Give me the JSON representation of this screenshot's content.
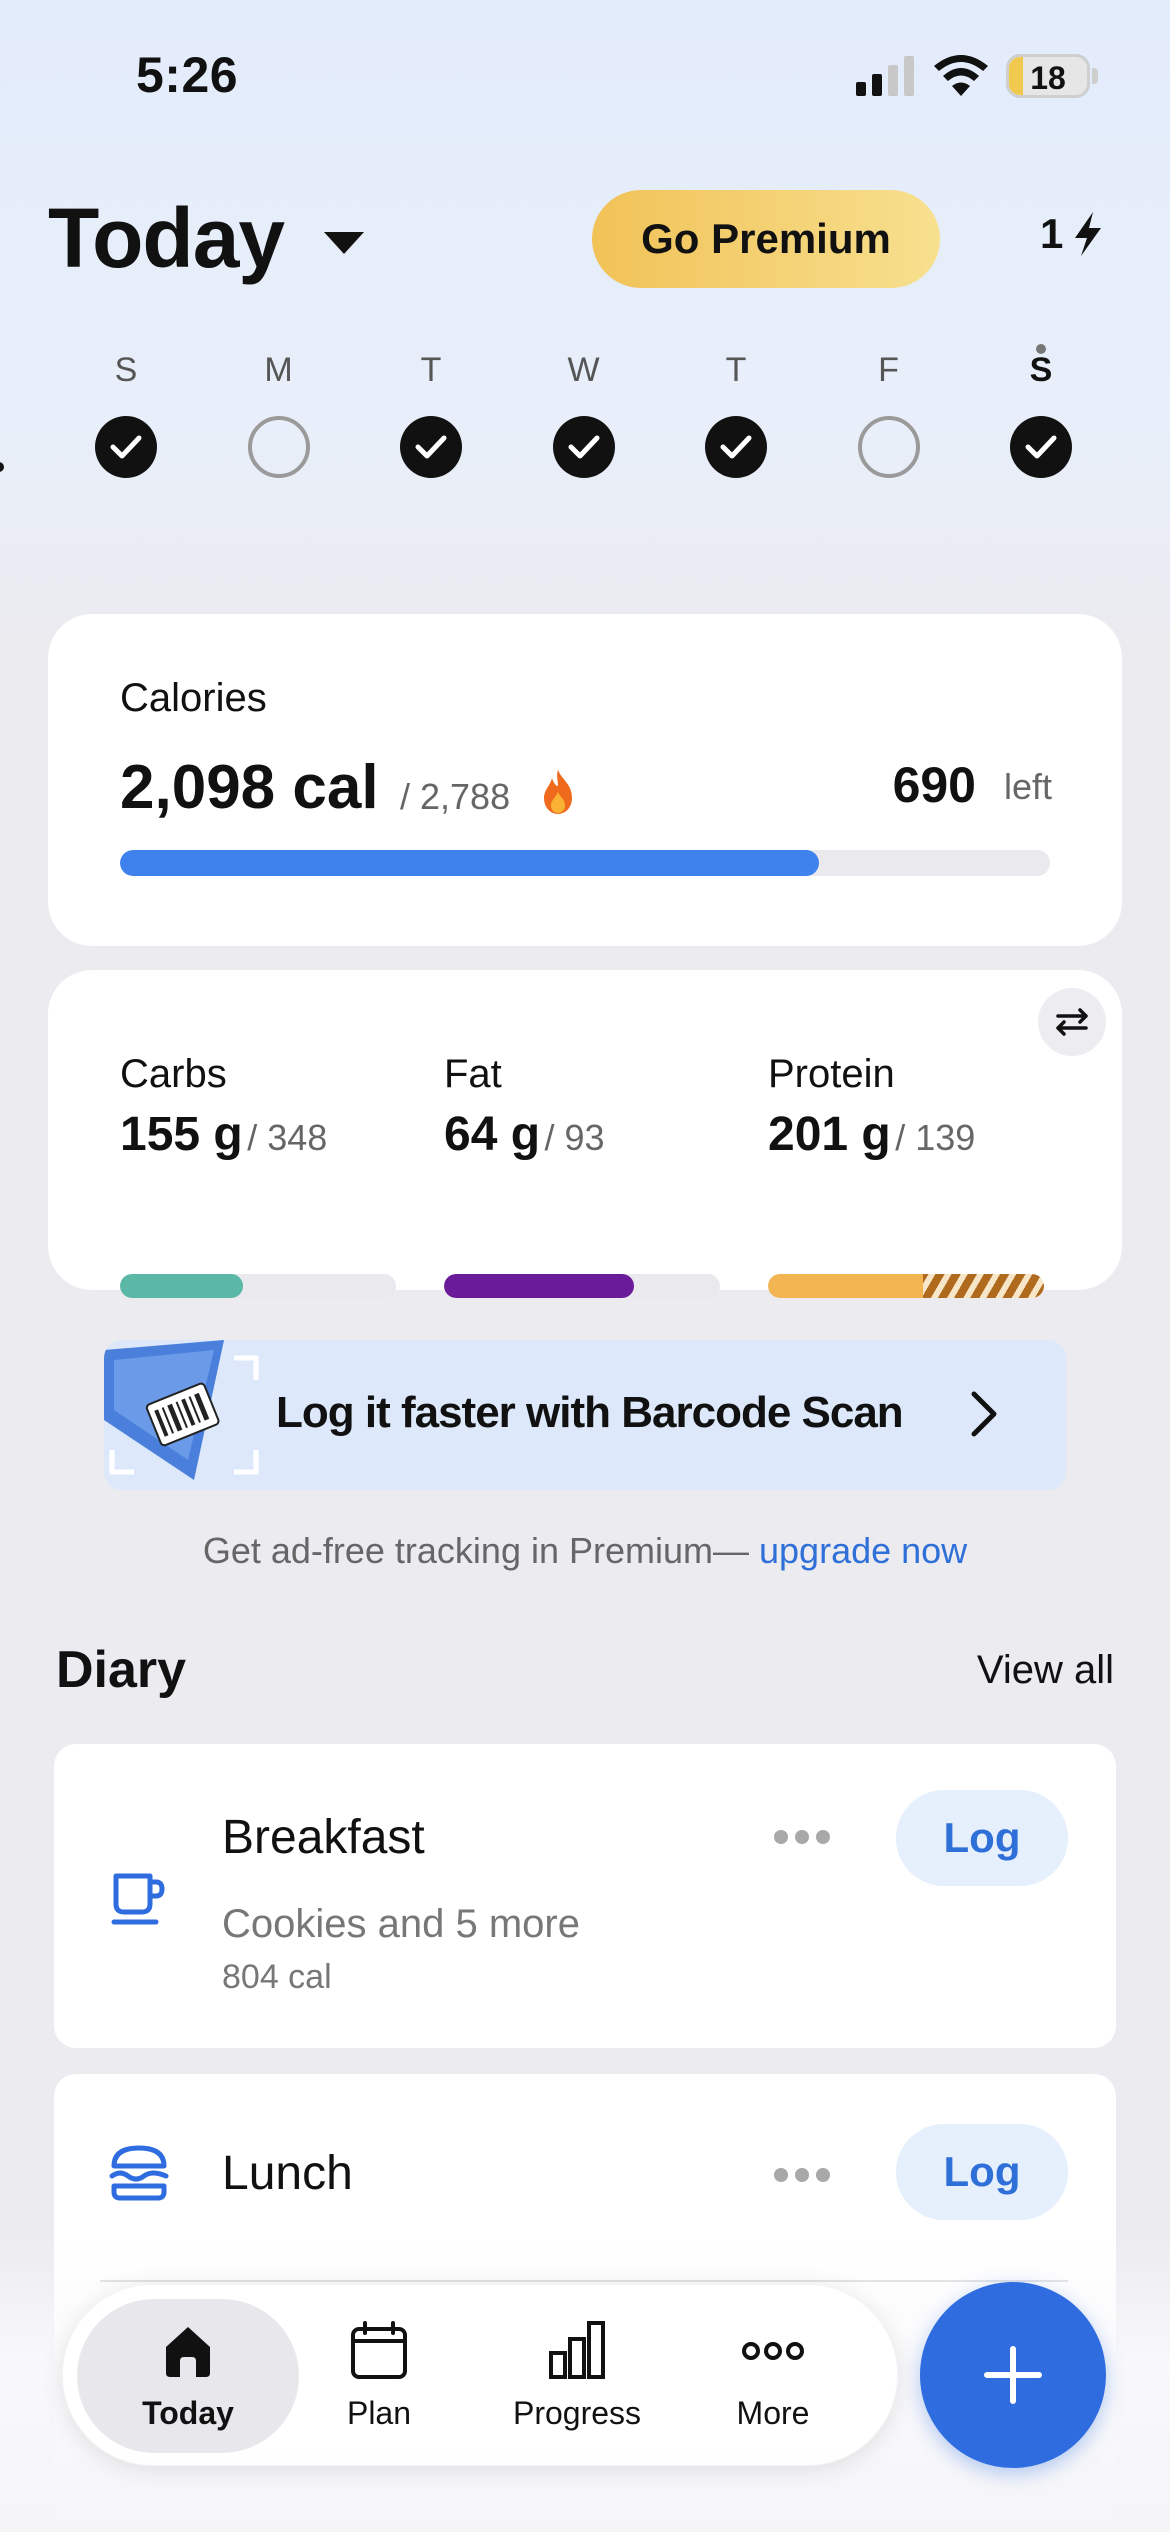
{
  "status_bar": {
    "time": "5:26",
    "battery": "18",
    "battery_level": 0.18
  },
  "header": {
    "title": "Today",
    "premium_label": "Go Premium",
    "streak_count": "1"
  },
  "week": {
    "days": [
      {
        "letter": "S",
        "logged": true,
        "today": false
      },
      {
        "letter": "M",
        "logged": false,
        "today": false
      },
      {
        "letter": "T",
        "logged": true,
        "today": false
      },
      {
        "letter": "W",
        "logged": true,
        "today": false
      },
      {
        "letter": "T",
        "logged": true,
        "today": false
      },
      {
        "letter": "F",
        "logged": false,
        "today": false
      },
      {
        "letter": "S",
        "logged": true,
        "today": true
      }
    ]
  },
  "calories": {
    "label": "Calories",
    "consumed": "2,098 cal",
    "goal": "/ 2,788",
    "remaining": "690",
    "remaining_label": "left",
    "progress": 0.752,
    "color": "#3f82ee"
  },
  "macros": [
    {
      "name": "Carbs",
      "value": "155 g",
      "goal": "/ 348",
      "progress": 0.445,
      "over": 0,
      "color": "#5bb8a6"
    },
    {
      "name": "Fat",
      "value": "64 g",
      "goal": "/ 93",
      "progress": 0.688,
      "over": 0,
      "color": "#6a1b9a"
    },
    {
      "name": "Protein",
      "value": "201 g",
      "goal": "/ 139",
      "progress": 0.56,
      "over": 0.44,
      "color": "#f2b552"
    }
  ],
  "banner": {
    "text": "Log it faster with Barcode Scan"
  },
  "promo": {
    "text": "Get ad-free tracking in Premium— ",
    "link": "upgrade now"
  },
  "diary": {
    "title": "Diary",
    "view_all": "View all",
    "meals": [
      {
        "name": "Breakfast",
        "items": "Cookies and 5 more",
        "calories": "804 cal",
        "log_label": "Log",
        "icon": "coffee-cup-icon"
      },
      {
        "name": "Lunch",
        "log_label": "Log",
        "icon": "burger-icon"
      }
    ]
  },
  "tabs": [
    {
      "label": "Today",
      "icon": "home-icon",
      "active": true
    },
    {
      "label": "Plan",
      "icon": "calendar-icon",
      "active": false
    },
    {
      "label": "Progress",
      "icon": "bar-chart-icon",
      "active": false
    },
    {
      "label": "More",
      "icon": "more-dots-icon",
      "active": false
    }
  ],
  "colors": {
    "accent": "#2f6ce0",
    "link": "#2f6fd8",
    "premium": "#f1c257"
  }
}
